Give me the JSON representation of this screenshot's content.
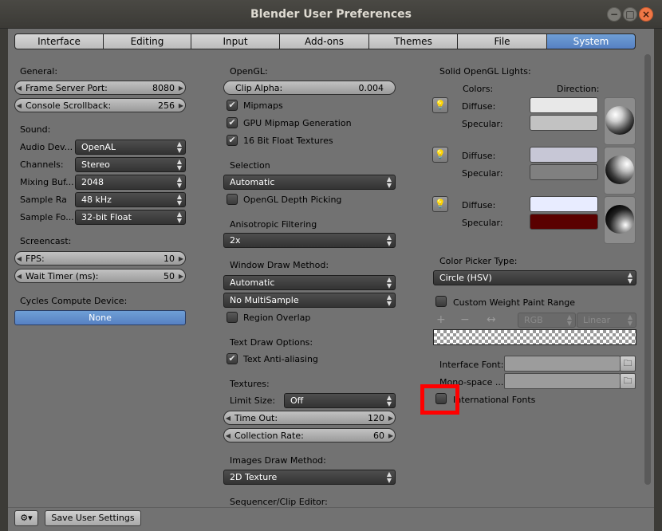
{
  "window": {
    "title": "Blender User Preferences",
    "controls": [
      "−",
      "□",
      "×"
    ]
  },
  "tabs": [
    "Interface",
    "Editing",
    "Input",
    "Add-ons",
    "Themes",
    "File",
    "System"
  ],
  "active_tab": "System",
  "col1": {
    "general_label": "General:",
    "frame_server_port": {
      "label": "Frame Server Port:",
      "value": "8080"
    },
    "console_scrollback": {
      "label": "Console Scrollback:",
      "value": "256"
    },
    "sound_label": "Sound:",
    "audio_device": {
      "label": "Audio Dev...",
      "value": "OpenAL"
    },
    "channels": {
      "label": "Channels:",
      "value": "Stereo"
    },
    "mixing_buffer": {
      "label": "Mixing Buf...",
      "value": "2048"
    },
    "sample_rate": {
      "label": "Sample Ra",
      "value": "48 kHz"
    },
    "sample_format": {
      "label": "Sample Fo...",
      "value": "32-bit Float"
    },
    "screencast_label": "Screencast:",
    "fps": {
      "label": "FPS:",
      "value": "10"
    },
    "wait_timer": {
      "label": "Wait Timer (ms):",
      "value": "50"
    },
    "cycles_label": "Cycles Compute Device:",
    "cycles_value": "None"
  },
  "col2": {
    "opengl_label": "OpenGL:",
    "clip_alpha": {
      "label": "Clip Alpha:",
      "value": "0.004"
    },
    "mipmaps": "Mipmaps",
    "gpu_mipmap": "GPU Mipmap Generation",
    "float_textures": "16 Bit Float Textures",
    "selection_label": "Selection",
    "selection_value": "Automatic",
    "depth_picking": "OpenGL Depth Picking",
    "aniso_label": "Anisotropic Filtering",
    "aniso_value": "2x",
    "window_draw_label": "Window Draw Method:",
    "window_draw_value": "Automatic",
    "multisample_value": "No MultiSample",
    "region_overlap": "Region Overlap",
    "text_draw_label": "Text Draw Options:",
    "anti_aliasing": "Text Anti-aliasing",
    "textures_label": "Textures:",
    "limit_size": {
      "label": "Limit Size:",
      "value": "Off"
    },
    "time_out": {
      "label": "Time Out:",
      "value": "120"
    },
    "collection_rate": {
      "label": "Collection Rate:",
      "value": "60"
    },
    "images_draw_label": "Images Draw Method:",
    "images_draw_value": "2D Texture",
    "sequencer_label": "Sequencer/Clip Editor:"
  },
  "col3": {
    "lights_label": "Solid OpenGL Lights:",
    "colors_label": "Colors:",
    "direction_label": "Direction:",
    "diffuse": "Diffuse:",
    "specular": "Specular:",
    "light_colors": [
      {
        "diffuse": "#e8e8e8",
        "specular": "#c2c2c2"
      },
      {
        "diffuse": "#c7c7d6",
        "specular": "#808080"
      },
      {
        "diffuse": "#e8ecff",
        "specular": "#5a0000"
      }
    ],
    "color_picker_label": "Color Picker Type:",
    "color_picker_value": "Circle (HSV)",
    "custom_weight": "Custom Weight Paint Range",
    "ramp_plus": "+",
    "ramp_minus": "−",
    "ramp_flip": "↔",
    "ramp_mode": "RGB",
    "ramp_interp": "Linear",
    "interface_font": "Interface Font:",
    "monospace_font": "Mono-space ...",
    "international_fonts": "International Fonts"
  },
  "status": {
    "save_label": "Save User Settings"
  },
  "highlight_color": "#ff0000",
  "accent": "#5680c2"
}
